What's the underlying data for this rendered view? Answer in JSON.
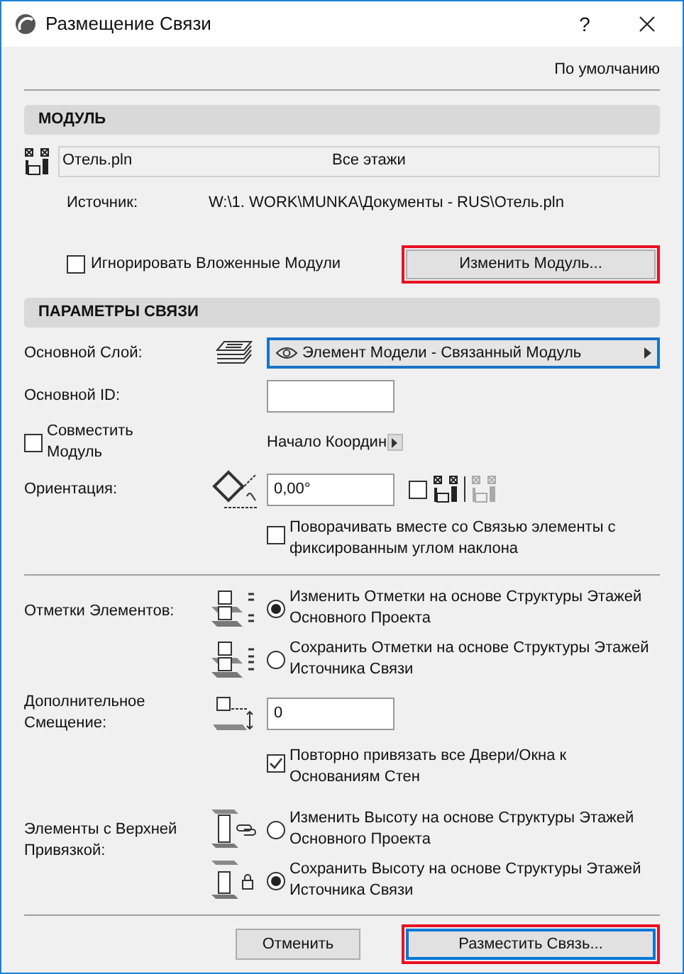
{
  "window": {
    "title": "Размещение Связи",
    "help": "?"
  },
  "defaults_link": "По умолчанию",
  "module_section": {
    "title": "МОДУЛЬ",
    "file": "Отель.pln",
    "stories": "Все этажи",
    "source_label": "Источник:",
    "source_path": "W:\\1. WORK\\MUNKA\\Документы - RUS\\Отель.pln",
    "ignore_nested": {
      "label": "Игнорировать Вложенные Модули",
      "checked": false
    },
    "change_button": {
      "label": "Изменить Модуль...",
      "highlighted": true
    }
  },
  "link_section": {
    "title": "ПАРАМЕТРЫ СВЯЗИ",
    "layer": {
      "label": "Основной Слой:",
      "value": "Элемент Модели - Связанный Модуль"
    },
    "id": {
      "label": "Основной ID:"
    },
    "match": {
      "label": "Совместить Модуль",
      "checked": false
    },
    "origin": "Начало Координ",
    "orientation": {
      "label": "Ориентация:",
      "value": "0,00°",
      "mirror_checked": false
    },
    "rotate_fixed": {
      "label": "Поворачивать вместе со Связью элементы с фиксированным углом наклона",
      "checked": false
    },
    "elevations": {
      "label": "Отметки Элементов:",
      "options": [
        {
          "label": "Изменить Отметки на основе Структуры Этажей Основного Проекта",
          "selected": true
        },
        {
          "label": "Сохранить Отметки на основе Структуры Этажей Источника Связи",
          "selected": false
        }
      ]
    },
    "offset": {
      "label": "Дополнительное Смещение:",
      "value": "0"
    },
    "reattach": {
      "label": "Повторно привязать все Двери/Окна к Основаниям Стен",
      "checked": true
    },
    "top_linked": {
      "label": "Элементы с Верхней Привязкой:",
      "options": [
        {
          "label": "Изменить Высоту на основе Структуры Этажей Основного Проекта",
          "selected": false
        },
        {
          "label": "Сохранить Высоту на основе Структуры Этажей Источника Связи",
          "selected": true
        }
      ]
    }
  },
  "buttons": [
    {
      "label": "Отменить",
      "default": false,
      "highlighted": false
    },
    {
      "label": "Разместить Связь...",
      "default": true,
      "highlighted": true
    }
  ]
}
